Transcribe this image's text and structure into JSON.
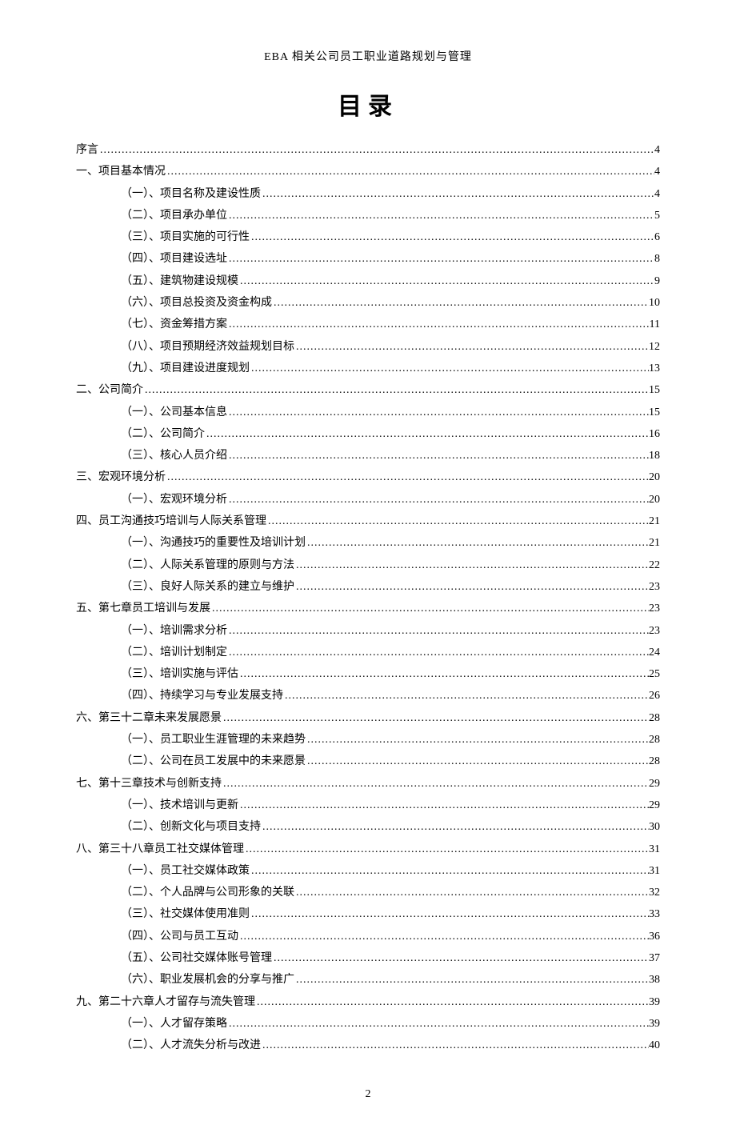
{
  "header": "EBA 相关公司员工职业道路规划与管理",
  "title": "目录",
  "page_number": "2",
  "toc": [
    {
      "level": 0,
      "label": "序言",
      "page": "4"
    },
    {
      "level": 0,
      "label": "一、项目基本情况",
      "page": "4"
    },
    {
      "level": 1,
      "label": "（一）、项目名称及建设性质",
      "page": "4"
    },
    {
      "level": 1,
      "label": "（二）、项目承办单位",
      "page": "5"
    },
    {
      "level": 1,
      "label": "（三）、项目实施的可行性",
      "page": "6"
    },
    {
      "level": 1,
      "label": "（四）、项目建设选址",
      "page": "8"
    },
    {
      "level": 1,
      "label": "（五）、建筑物建设规模",
      "page": "9"
    },
    {
      "level": 1,
      "label": "（六）、项目总投资及资金构成",
      "page": "10"
    },
    {
      "level": 1,
      "label": "（七）、资金筹措方案",
      "page": "11"
    },
    {
      "level": 1,
      "label": "（八）、项目预期经济效益规划目标",
      "page": "12"
    },
    {
      "level": 1,
      "label": "（九）、项目建设进度规划",
      "page": "13"
    },
    {
      "level": 0,
      "label": "二、公司简介",
      "page": "15"
    },
    {
      "level": 1,
      "label": "（一）、公司基本信息",
      "page": "15"
    },
    {
      "level": 1,
      "label": "（二）、公司简介",
      "page": "16"
    },
    {
      "level": 1,
      "label": "（三）、核心人员介绍",
      "page": "18"
    },
    {
      "level": 0,
      "label": "三、宏观环境分析",
      "page": "20"
    },
    {
      "level": 1,
      "label": "（一）、宏观环境分析",
      "page": "20"
    },
    {
      "level": 0,
      "label": "四、员工沟通技巧培训与人际关系管理",
      "page": "21"
    },
    {
      "level": 1,
      "label": "（一）、沟通技巧的重要性及培训计划",
      "page": "21"
    },
    {
      "level": 1,
      "label": "（二）、人际关系管理的原则与方法",
      "page": "22"
    },
    {
      "level": 1,
      "label": "（三）、良好人际关系的建立与维护",
      "page": "23"
    },
    {
      "level": 0,
      "label": "五、第七章员工培训与发展",
      "page": "23"
    },
    {
      "level": 1,
      "label": "（一）、培训需求分析",
      "page": "23"
    },
    {
      "level": 1,
      "label": "（二）、培训计划制定",
      "page": "24"
    },
    {
      "level": 1,
      "label": "（三）、培训实施与评估",
      "page": "25"
    },
    {
      "level": 1,
      "label": "（四）、持续学习与专业发展支持",
      "page": "26"
    },
    {
      "level": 0,
      "label": "六、第三十二章未来发展愿景",
      "page": "28"
    },
    {
      "level": 1,
      "label": "（一）、员工职业生涯管理的未来趋势",
      "page": "28"
    },
    {
      "level": 1,
      "label": "（二）、公司在员工发展中的未来愿景",
      "page": "28"
    },
    {
      "level": 0,
      "label": "七、第十三章技术与创新支持",
      "page": "29"
    },
    {
      "level": 1,
      "label": "（一）、技术培训与更新",
      "page": "29"
    },
    {
      "level": 1,
      "label": "（二）、创新文化与项目支持",
      "page": "30"
    },
    {
      "level": 0,
      "label": "八、第三十八章员工社交媒体管理",
      "page": "31"
    },
    {
      "level": 1,
      "label": "（一）、员工社交媒体政策",
      "page": "31"
    },
    {
      "level": 1,
      "label": "（二）、个人品牌与公司形象的关联",
      "page": "32"
    },
    {
      "level": 1,
      "label": "（三）、社交媒体使用准则",
      "page": "33"
    },
    {
      "level": 1,
      "label": "（四）、公司与员工互动",
      "page": "36"
    },
    {
      "level": 1,
      "label": "（五）、公司社交媒体账号管理",
      "page": "37"
    },
    {
      "level": 1,
      "label": "（六）、职业发展机会的分享与推广",
      "page": "38"
    },
    {
      "level": 0,
      "label": "九、第二十六章人才留存与流失管理",
      "page": "39"
    },
    {
      "level": 1,
      "label": "（一）、人才留存策略",
      "page": "39"
    },
    {
      "level": 1,
      "label": "（二）、人才流失分析与改进",
      "page": "40"
    }
  ]
}
